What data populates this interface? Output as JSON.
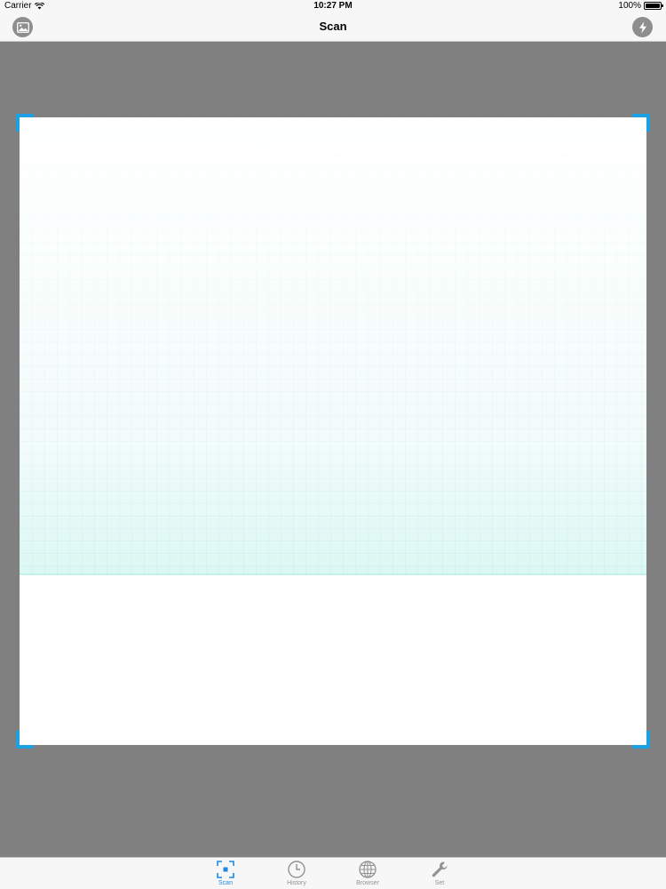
{
  "status_bar": {
    "carrier": "Carrier",
    "time": "10:27 PM",
    "battery": "100%",
    "battery_level_percent": 100
  },
  "nav_bar": {
    "title": "Scan",
    "left_icon": "image-icon",
    "right_icon": "flash-icon"
  },
  "scanner": {
    "accent_color": "#1ea1e3",
    "background_color": "#808080"
  },
  "tab_bar": {
    "active_color": "#1e88e5",
    "inactive_color": "#929292",
    "tabs": [
      {
        "label": "Scan",
        "icon": "scan-icon",
        "active": true
      },
      {
        "label": "History",
        "icon": "clock-icon",
        "active": false
      },
      {
        "label": "Browser",
        "icon": "globe-icon",
        "active": false
      },
      {
        "label": "Set",
        "icon": "wrench-icon",
        "active": false
      }
    ]
  }
}
